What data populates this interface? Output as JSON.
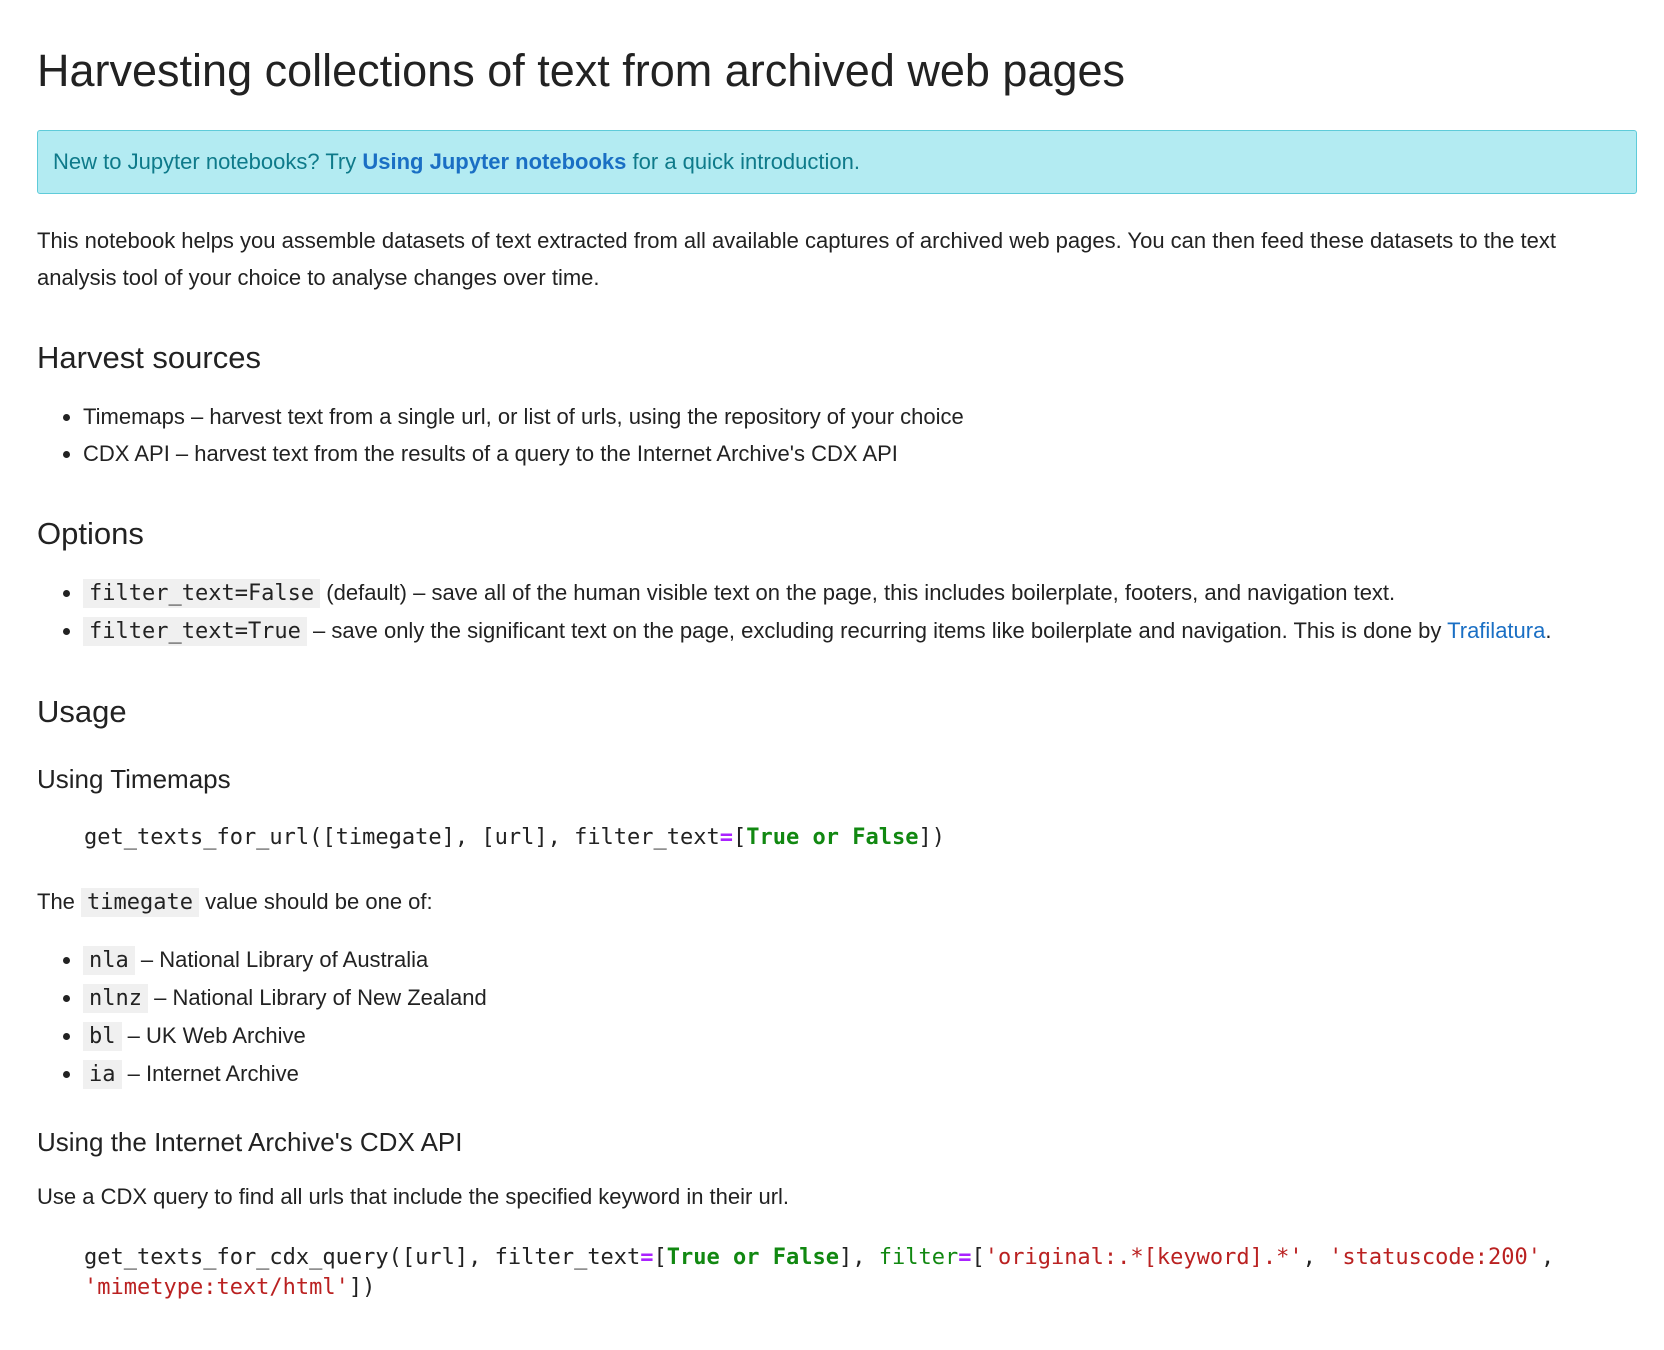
{
  "title": "Harvesting collections of text from archived web pages",
  "alert": {
    "prefix": "New to Jupyter notebooks? Try ",
    "link": "Using Jupyter notebooks",
    "suffix": " for a quick introduction."
  },
  "intro": "This notebook helps you assemble datasets of text extracted from all available captures of archived web pages. You can then feed these datasets to the text analysis tool of your choice to analyse changes over time.",
  "harvest_sources": {
    "heading": "Harvest sources",
    "items": [
      "Timemaps – harvest text from a single url, or list of urls, using the repository of your choice",
      "CDX API – harvest text from the results of a query to the Internet Archive's CDX API"
    ]
  },
  "options": {
    "heading": "Options",
    "item1_code": "filter_text=False",
    "item1_text": " (default) – save all of the human visible text on the page, this includes boilerplate, footers, and navigation text.",
    "item2_code": "filter_text=True",
    "item2_text": " – save only the significant text on the page, excluding recurring items like boilerplate and navigation. This is done by ",
    "item2_link": "Trafilatura",
    "item2_end": "."
  },
  "usage": {
    "heading": "Usage",
    "timemaps_heading": "Using Timemaps",
    "code1": {
      "a": "get_texts_for_url([timegate], [url], filter_text",
      "eq": "=",
      "b": "[",
      "kw": "True or False",
      "c": "])"
    },
    "timegate_pre": "The ",
    "timegate_code": "timegate",
    "timegate_post": " value should be one of:",
    "timegates": [
      {
        "code": "nla",
        "text": " – National Library of Australia"
      },
      {
        "code": "nlnz",
        "text": " – National Library of New Zealand"
      },
      {
        "code": "bl",
        "text": " – UK Web Archive"
      },
      {
        "code": "ia",
        "text": " – Internet Archive"
      }
    ],
    "cdx_heading": "Using the Internet Archive's CDX API",
    "cdx_desc": "Use a CDX query to find all urls that include the specified keyword in their url.",
    "code2": {
      "a": "get_texts_for_cdx_query([url], filter_text",
      "eq1": "=",
      "b": "[",
      "kw": "True or False",
      "c": "], ",
      "nm": "filter",
      "eq2": "=",
      "d": "[",
      "s1": "'original:.*[keyword].*'",
      "e": ", ",
      "s2": "'statuscode:200'",
      "f": ", ",
      "s3": "'mimetype:text/html'",
      "g": "])"
    }
  }
}
